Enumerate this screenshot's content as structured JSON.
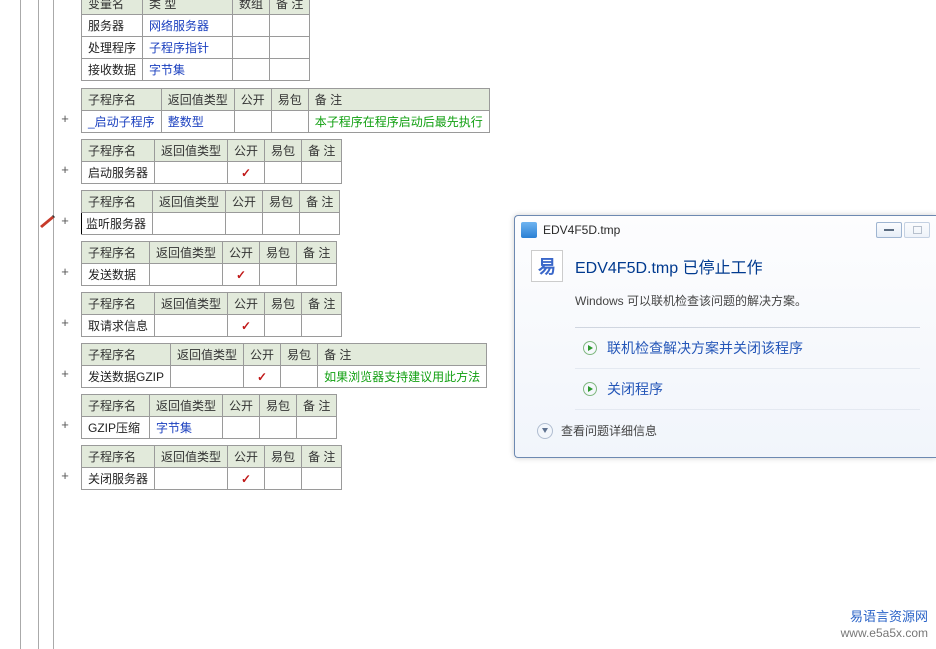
{
  "variables": {
    "headers": {
      "name": "变量名",
      "type": "类 型",
      "array": "数组",
      "note": "备 注"
    },
    "rows": [
      {
        "name": "服务器",
        "type": "网络服务器"
      },
      {
        "name": "处理程序",
        "type": "子程序指针"
      },
      {
        "name": "接收数据",
        "type": "字节集"
      }
    ]
  },
  "sub_headers": {
    "name": "子程序名",
    "return": "返回值类型",
    "public": "公开",
    "pack": "易包",
    "note": "备 注"
  },
  "subs": [
    {
      "name": "_启动子程序",
      "return": "整数型",
      "public": "",
      "pack": "",
      "note": "本子程序在程序启动后最先执行",
      "name_link": true,
      "return_link": true,
      "note_green": true
    },
    {
      "name": "启动服务器",
      "return": "",
      "public": "check",
      "pack": "",
      "note": ""
    },
    {
      "name": "监听服务器",
      "return": "",
      "public": "",
      "pack": "",
      "note": "",
      "cursor": true,
      "pencil": true
    },
    {
      "name": "发送数据",
      "return": "",
      "public": "check",
      "pack": "",
      "note": ""
    },
    {
      "name": "取请求信息",
      "return": "",
      "public": "check",
      "pack": "",
      "note": ""
    },
    {
      "name": "发送数据GZIP",
      "return": "",
      "public": "check",
      "pack": "",
      "note": "如果浏览器支持建议用此方法",
      "note_green": true
    },
    {
      "name": "GZIP压缩",
      "return": "字节集",
      "public": "",
      "pack": "",
      "note": "",
      "return_link": true
    },
    {
      "name": "关闭服务器",
      "return": "",
      "public": "check",
      "pack": "",
      "note": ""
    }
  ],
  "dialog": {
    "title": "EDV4F5D.tmp",
    "heading": "EDV4F5D.tmp 已停止工作",
    "subtext": "Windows 可以联机检查该问题的解决方案。",
    "option1": "联机检查解决方案并关闭该程序",
    "option2": "关闭程序",
    "details": "查看问题详细信息",
    "icon_glyph": "易"
  },
  "watermark": {
    "line1": "易语言资源网",
    "line2": "www.e5a5x.com"
  },
  "col_widths": {
    "vars": {
      "name": 60,
      "type": 90,
      "array": 36,
      "note": 36
    },
    "std": {
      "name": 68,
      "return": 70,
      "public": 30,
      "pack": 32,
      "note": 38
    }
  }
}
